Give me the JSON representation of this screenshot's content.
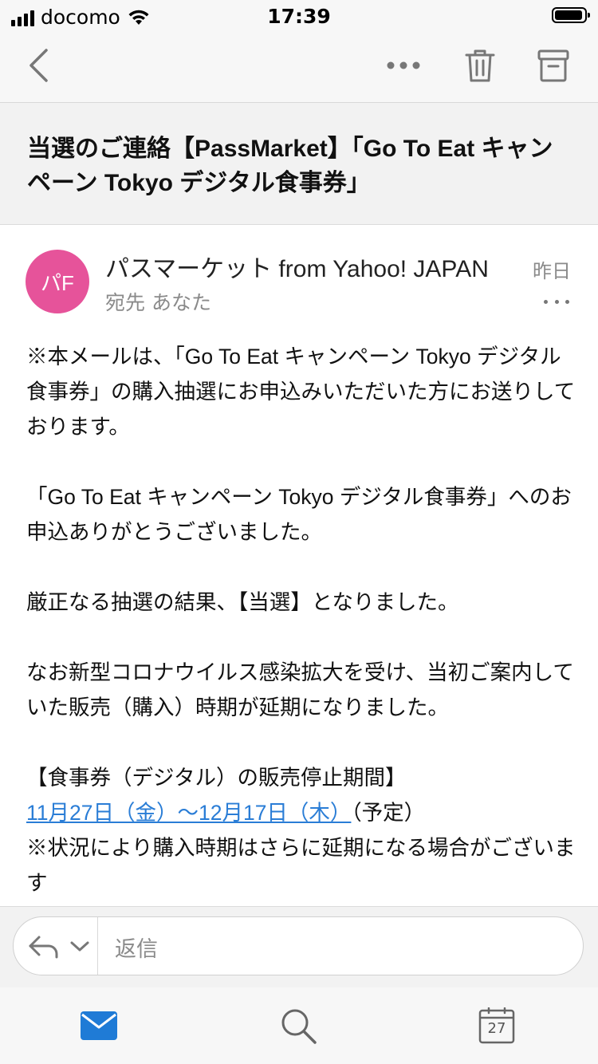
{
  "status_bar": {
    "carrier": "docomo",
    "time": "17:39"
  },
  "toolbar": {
    "back_icon": "chevron-left-icon",
    "more_icon": "more-horizontal-icon",
    "delete_icon": "trash-icon",
    "archive_icon": "archive-icon",
    "icon_color": "#777777"
  },
  "message": {
    "subject": "当選のご連絡【PassMarket】「Go To Eat キャンペーン Tokyo デジタル食事券」",
    "sender": {
      "initials": "パF",
      "name": "パスマーケット from Yahoo! JAPAN",
      "recipient": "宛先 あなた",
      "date": "昨日",
      "avatar_color": "#e6539a"
    },
    "body": {
      "p1": "※本メールは、「Go To Eat キャンペーン Tokyo デジタル食事券」の購入抽選にお申込みいただいた方にお送りしております。",
      "p2": "「Go To Eat キャンペーン Tokyo デジタル食事券」へのお申込ありがとうございました。",
      "p3": "厳正なる抽選の結果、【当選】となりました。",
      "p4": "なお新型コロナウイルス感染拡大を受け、当初ご案内していた販売（購入）時期が延期になりました。",
      "p5_heading": "【食事券（デジタル）の販売停止期間】",
      "p5_date_link": "11月27日（金）～12月17日（木）",
      "p5_date_suffix": "（予定）",
      "p5_note": "※状況により購入時期はさらに延期になる場合がございます",
      "link_color": "#2a7dd6"
    }
  },
  "reply_bar": {
    "placeholder": "返信",
    "reply_icon": "reply-icon",
    "dropdown_icon": "chevron-down-icon"
  },
  "tab_bar": {
    "mail_icon": "mail-icon",
    "search_icon": "search-icon",
    "calendar_icon": "calendar-icon",
    "calendar_day": "27",
    "active_color": "#1f7bd6"
  }
}
